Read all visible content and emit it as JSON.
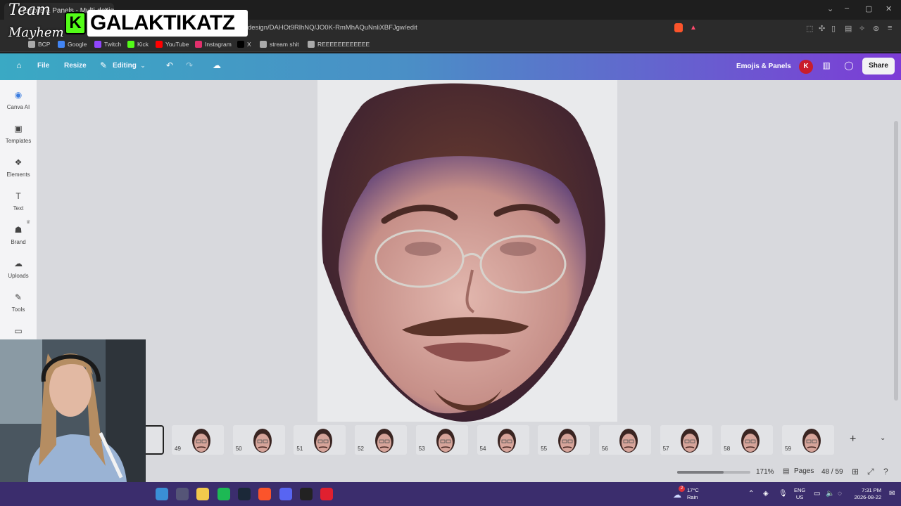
{
  "browser": {
    "tab_title": "Emojis & Panels - Multi-design",
    "tab_close": "×",
    "url": "design/DAHOt9RlhNQ/JO0K-RmMhAQuNnliXBFJgw/edit",
    "window_buttons": [
      "⌄",
      "–",
      "▢",
      "✕"
    ],
    "bookmarks": [
      {
        "label": "BCP",
        "icon": "folder-icon",
        "color": "#aaaaaa"
      },
      {
        "label": "Google",
        "icon": "google-icon",
        "color": "#4285f4"
      },
      {
        "label": "Twitch",
        "icon": "twitch-icon",
        "color": "#9146ff"
      },
      {
        "label": "Kick",
        "icon": "kick-icon",
        "color": "#53fc18"
      },
      {
        "label": "YouTube",
        "icon": "youtube-icon",
        "color": "#ff0000"
      },
      {
        "label": "Instagram",
        "icon": "instagram-icon",
        "color": "#e1306c"
      },
      {
        "label": "X",
        "icon": "x-icon",
        "color": "#000000"
      },
      {
        "label": "stream shit",
        "icon": "folder-icon",
        "color": "#aaaaaa"
      },
      {
        "label": "REEEEEEEEEEEE",
        "icon": "folder-icon",
        "color": "#aaaaaa"
      }
    ]
  },
  "overlay": {
    "team": "Team",
    "mayhem": "Mayhem",
    "logo_letter": "K",
    "logo_name": "GALAKTIKATZ"
  },
  "canva": {
    "header": {
      "file": "File",
      "resize": "Resize",
      "editing": "Editing",
      "design_title": "Emojis & Panels",
      "avatar_letter": "K",
      "share": "Share"
    },
    "sidebar": [
      {
        "label": "Canva AI",
        "icon": "canva-ai-icon",
        "glyph": "◉"
      },
      {
        "label": "Templates",
        "icon": "templates-icon",
        "glyph": "▣"
      },
      {
        "label": "Elements",
        "icon": "elements-icon",
        "glyph": "❖"
      },
      {
        "label": "Text",
        "icon": "text-icon",
        "glyph": "T"
      },
      {
        "label": "Brand",
        "icon": "brand-icon",
        "glyph": "☗"
      },
      {
        "label": "Uploads",
        "icon": "uploads-icon",
        "glyph": "☁"
      },
      {
        "label": "Tools",
        "icon": "tools-icon",
        "glyph": "✎"
      },
      {
        "label": "",
        "icon": "projects-icon",
        "glyph": "▭"
      }
    ],
    "thumbnails": [
      "49",
      "50",
      "51",
      "52",
      "53",
      "54",
      "55",
      "56",
      "57",
      "58",
      "59"
    ],
    "footer": {
      "zoom": "171%",
      "zoom_fraction": 0.63,
      "pages_label": "Pages",
      "page_count": "48 / 59"
    }
  },
  "taskbar": {
    "weather_temp": "17°C",
    "weather_desc": "Rain",
    "weather_badge": "2",
    "lang_1": "ENG",
    "lang_2": "US",
    "time": "7:31 PM",
    "date": "2026-08-22",
    "apps": [
      {
        "icon": "photos-icon",
        "color": "#3a8fd6"
      },
      {
        "icon": "calculator-icon",
        "color": "#555577"
      },
      {
        "icon": "file-explorer-icon",
        "color": "#f2c94c"
      },
      {
        "icon": "spotify-icon",
        "color": "#1db954"
      },
      {
        "icon": "steam-icon",
        "color": "#1b2838"
      },
      {
        "icon": "brave-icon",
        "color": "#fb542b"
      },
      {
        "icon": "discord-icon",
        "color": "#5865f2"
      },
      {
        "icon": "obs-icon",
        "color": "#222222"
      },
      {
        "icon": "opera-icon",
        "color": "#e0202f"
      }
    ]
  }
}
